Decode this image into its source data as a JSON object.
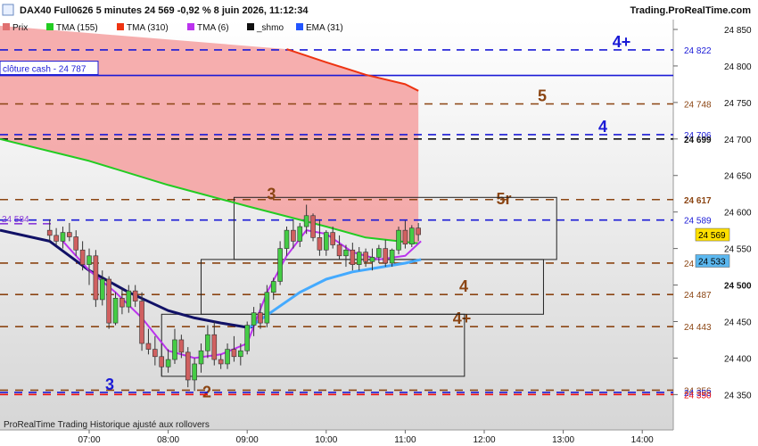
{
  "header": {
    "title": "DAX40 Full0626 5 minutes 24 569 -0,92 % 8 juin 2026, 11:12:34",
    "site": "Trading.ProRealTime.com"
  },
  "legend": [
    {
      "label": "Prix",
      "color": "#e07070"
    },
    {
      "label": "TMA (155)",
      "color": "#22cc22"
    },
    {
      "label": "TMA (310)",
      "color": "#ee3311"
    },
    {
      "label": "TMA (6)",
      "color": "#bb33ee"
    },
    {
      "label": "_shmo",
      "color": "#111111"
    },
    {
      "label": "EMA (31)",
      "color": "#2255ff"
    }
  ],
  "footer": "ProRealTime Trading  Historique ajusté aux rollovers",
  "cash_close_label": "clôture cash -  24 787",
  "chart_data": {
    "type": "candlestick",
    "timeframe": "5 minutes",
    "y_ticks": [
      24850,
      24800,
      24750,
      24700,
      24650,
      24600,
      24550,
      24500,
      24450,
      24400,
      24350
    ],
    "y_tick_labels": [
      "24 850",
      "24 800",
      "24 750",
      "24 700",
      "24 650",
      "24 600",
      "24 550",
      "24 500",
      "24 450",
      "24 400",
      "24 350"
    ],
    "y_bold_tick": "24 500",
    "ylim": [
      24340,
      24860
    ],
    "x_ticks": [
      "07:00",
      "08:00",
      "09:00",
      "10:00",
      "11:00",
      "12:00",
      "13:00",
      "14:00"
    ],
    "levels": [
      {
        "value": 24822,
        "label": "24 822",
        "color": "#1a1ad6",
        "tag": "4+"
      },
      {
        "value": 24787,
        "label": "24 787",
        "color": "#1a1ad6",
        "tag": ""
      },
      {
        "value": 24748,
        "label": "24 748",
        "color": "#8b4513",
        "tag": "5"
      },
      {
        "value": 24706,
        "label": "24 706",
        "color": "#1a1ad6",
        "tag": "4"
      },
      {
        "value": 24700,
        "label": "24 699",
        "color": "#111111",
        "tag": ""
      },
      {
        "value": 24617,
        "label": "24 617",
        "color": "#8b4513",
        "tag": "5r"
      },
      {
        "value": 24589,
        "label": "24 589",
        "color": "#1a1ad6",
        "tag": ""
      },
      {
        "value": 24584,
        "label": "24 584",
        "color": "#8a3ad8",
        "tag": ""
      },
      {
        "value": 24530,
        "label": "24 530",
        "color": "#8b4513",
        "tag": ""
      },
      {
        "value": 24487,
        "label": "24 487",
        "color": "#8b4513",
        "tag": "4"
      },
      {
        "value": 24443,
        "label": "24 443",
        "color": "#8b4513",
        "tag": "4+"
      },
      {
        "value": 24356,
        "label": "24 356",
        "color": "#8b4513",
        "tag": "2"
      },
      {
        "value": 24353,
        "label": "24 353",
        "color": "#1a1ad6",
        "tag": "3"
      },
      {
        "value": 24350,
        "label": "24 350",
        "color": "#ee1111",
        "tag": ""
      }
    ],
    "zone_labels": [
      "3"
    ],
    "price_tags": [
      {
        "label": "24 569",
        "value": 24569,
        "bg": "#ffe000",
        "fg": "#000000"
      },
      {
        "label": "24 533",
        "value": 24533,
        "bg": "#5bb8f0",
        "fg": "#000000"
      }
    ],
    "series": [
      {
        "name": "Prix",
        "kind": "ohlc",
        "x": [
          "06:30",
          "06:35",
          "06:40",
          "06:45",
          "06:50",
          "06:55",
          "07:00",
          "07:05",
          "07:10",
          "07:15",
          "07:20",
          "07:25",
          "07:30",
          "07:35",
          "07:40",
          "07:45",
          "07:50",
          "07:55",
          "08:00",
          "08:05",
          "08:10",
          "08:15",
          "08:20",
          "08:25",
          "08:30",
          "08:35",
          "08:40",
          "08:45",
          "08:50",
          "08:55",
          "09:00",
          "09:05",
          "09:10",
          "09:15",
          "09:20",
          "09:25",
          "09:30",
          "09:35",
          "09:40",
          "09:45",
          "09:50",
          "09:55",
          "10:00",
          "10:05",
          "10:10",
          "10:15",
          "10:20",
          "10:25",
          "10:30",
          "10:35",
          "10:40",
          "10:45",
          "10:50",
          "10:55",
          "11:00",
          "11:05",
          "11:10"
        ],
        "ohlc": [
          [
            24575,
            24590,
            24560,
            24568
          ],
          [
            24568,
            24578,
            24555,
            24560
          ],
          [
            24560,
            24580,
            24550,
            24572
          ],
          [
            24572,
            24585,
            24560,
            24566
          ],
          [
            24566,
            24575,
            24540,
            24548
          ],
          [
            24548,
            24560,
            24520,
            24528
          ],
          [
            24528,
            24550,
            24500,
            24540
          ],
          [
            24540,
            24548,
            24470,
            24480
          ],
          [
            24480,
            24520,
            24472,
            24508
          ],
          [
            24508,
            24512,
            24440,
            24448
          ],
          [
            24448,
            24490,
            24445,
            24482
          ],
          [
            24482,
            24495,
            24460,
            24470
          ],
          [
            24470,
            24500,
            24462,
            24492
          ],
          [
            24492,
            24500,
            24470,
            24478
          ],
          [
            24478,
            24490,
            24410,
            24420
          ],
          [
            24420,
            24440,
            24405,
            24412
          ],
          [
            24412,
            24430,
            24390,
            24402
          ],
          [
            24402,
            24420,
            24375,
            24388
          ],
          [
            24388,
            24412,
            24380,
            24398
          ],
          [
            24398,
            24440,
            24392,
            24425
          ],
          [
            24425,
            24432,
            24400,
            24408
          ],
          [
            24408,
            24415,
            24360,
            24370
          ],
          [
            24370,
            24400,
            24355,
            24392
          ],
          [
            24392,
            24420,
            24380,
            24410
          ],
          [
            24410,
            24445,
            24400,
            24432
          ],
          [
            24432,
            24450,
            24390,
            24398
          ],
          [
            24398,
            24405,
            24385,
            24392
          ],
          [
            24392,
            24420,
            24385,
            24412
          ],
          [
            24412,
            24430,
            24395,
            24402
          ],
          [
            24402,
            24420,
            24390,
            24410
          ],
          [
            24410,
            24450,
            24405,
            24445
          ],
          [
            24445,
            24470,
            24430,
            24462
          ],
          [
            24462,
            24475,
            24440,
            24448
          ],
          [
            24448,
            24500,
            24442,
            24490
          ],
          [
            24490,
            24510,
            24480,
            24505
          ],
          [
            24505,
            24560,
            24500,
            24550
          ],
          [
            24550,
            24580,
            24540,
            24575
          ],
          [
            24575,
            24590,
            24550,
            24560
          ],
          [
            24560,
            24585,
            24552,
            24580
          ],
          [
            24580,
            24610,
            24570,
            24595
          ],
          [
            24595,
            24598,
            24560,
            24565
          ],
          [
            24565,
            24590,
            24540,
            24548
          ],
          [
            24548,
            24575,
            24540,
            24572
          ],
          [
            24572,
            24580,
            24550,
            24555
          ],
          [
            24555,
            24568,
            24535,
            24540
          ],
          [
            24540,
            24555,
            24525,
            24548
          ],
          [
            24548,
            24558,
            24520,
            24528
          ],
          [
            24528,
            24552,
            24520,
            24545
          ],
          [
            24545,
            24550,
            24525,
            24532
          ],
          [
            24532,
            24550,
            24520,
            24538
          ],
          [
            24538,
            24555,
            24530,
            24550
          ],
          [
            24550,
            24562,
            24525,
            24530
          ],
          [
            24530,
            24550,
            24525,
            24548
          ],
          [
            24548,
            24580,
            24542,
            24575
          ],
          [
            24575,
            24588,
            24550,
            24556
          ],
          [
            24556,
            24582,
            24552,
            24578
          ],
          [
            24578,
            24585,
            24560,
            24569
          ]
        ]
      },
      {
        "name": "TMA (155)",
        "color": "#22cc22",
        "x": [
          "05:45",
          "07:00",
          "08:00",
          "09:00",
          "10:00",
          "10:30",
          "11:10"
        ],
        "y": [
          24700,
          24670,
          24637,
          24608,
          24580,
          24565,
          24557
        ]
      },
      {
        "name": "TMA (310)",
        "color": "#ee3311",
        "x": [
          "09:30",
          "10:00",
          "10:30",
          "11:00",
          "11:10"
        ],
        "y": [
          24823,
          24805,
          24788,
          24775,
          24766
        ]
      },
      {
        "name": "_shmo",
        "color": "#111166",
        "x": [
          "05:45",
          "06:30",
          "07:00",
          "07:30",
          "08:00",
          "08:20",
          "08:40",
          "09:00",
          "09:05"
        ],
        "y": [
          24575,
          24560,
          24520,
          24490,
          24465,
          24455,
          24448,
          24442,
          24443
        ]
      },
      {
        "name": "TMA (6)",
        "color": "#bb33ee",
        "x": [
          "06:40",
          "07:00",
          "07:20",
          "07:40",
          "08:00",
          "08:20",
          "08:40",
          "09:00",
          "09:15",
          "09:30",
          "09:45",
          "10:00",
          "10:20",
          "10:40",
          "11:00",
          "11:12"
        ],
        "y": [
          24560,
          24520,
          24490,
          24455,
          24410,
          24400,
          24405,
          24420,
          24490,
          24540,
          24575,
          24570,
          24545,
          24535,
          24540,
          24560
        ]
      },
      {
        "name": "EMA (31)",
        "color": "#44aaff",
        "x": [
          "09:00",
          "09:20",
          "09:40",
          "10:00",
          "10:20",
          "10:40",
          "11:00",
          "11:12"
        ],
        "y": [
          24440,
          24465,
          24490,
          24508,
          24518,
          24524,
          24530,
          24535
        ]
      }
    ],
    "fill_between": {
      "upper": "TMA (310)",
      "lower": "TMA (155)",
      "color": "#f4a0a0"
    },
    "boxes": [
      {
        "x0": "08:50",
        "x1": "12:55",
        "y0": 24535,
        "y1": 24620
      },
      {
        "x0": "08:25",
        "x1": "12:45",
        "y0": 24460,
        "y1": 24535
      },
      {
        "x0": "07:55",
        "x1": "11:45",
        "y0": 24375,
        "y1": 24460
      }
    ]
  }
}
